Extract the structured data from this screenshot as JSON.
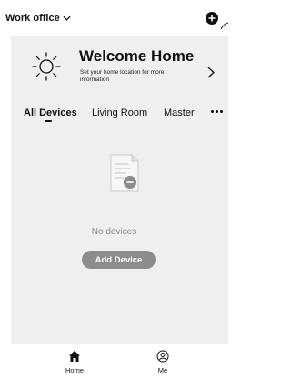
{
  "header": {
    "home_name": "Work office",
    "chevron_icon": "chevron-down-icon",
    "add_icon": "plus-circle-icon"
  },
  "welcome": {
    "icon": "sun-icon",
    "title": "Welcome Home",
    "subtitle": "Set your home location for more information",
    "arrow_icon": "chevron-right-icon"
  },
  "tabs": [
    {
      "label": "All Devices",
      "active": true
    },
    {
      "label": "Living Room",
      "active": false
    },
    {
      "label": "Master",
      "active": false
    }
  ],
  "tabs_more_icon": "more-dots-icon",
  "empty_state": {
    "icon": "document-icon",
    "message": "No devices",
    "button_label": "Add Device"
  },
  "bottom_nav": [
    {
      "label": "Home",
      "icon": "home-icon",
      "active": true
    },
    {
      "label": "Me",
      "icon": "user-icon",
      "active": false
    }
  ],
  "colors": {
    "content_bg": "#efefef",
    "button_bg": "#8c8c8c",
    "muted_text": "#888888"
  }
}
